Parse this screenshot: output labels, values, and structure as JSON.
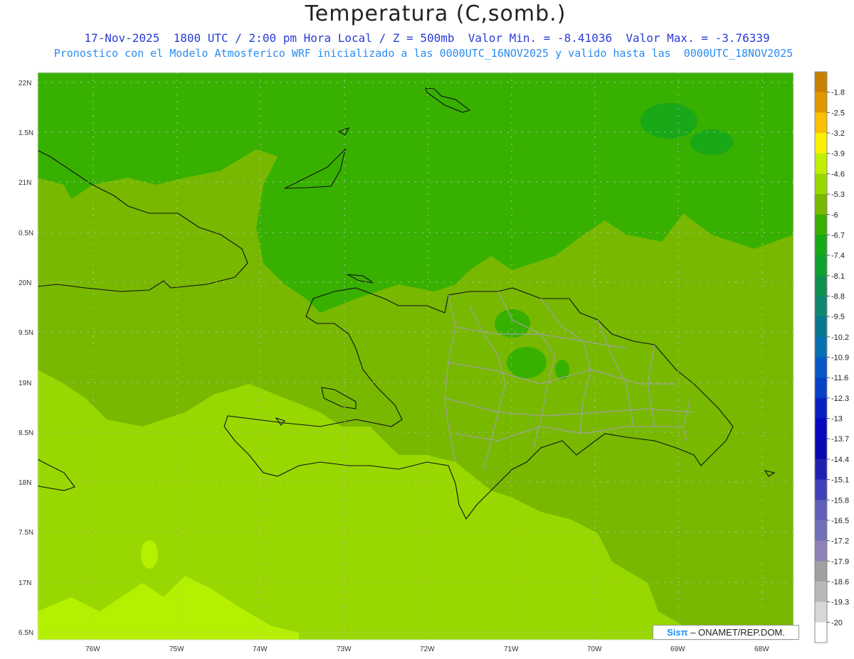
{
  "header": {
    "title": "Temperatura (C,somb.)",
    "line1": "17-Nov-2025  1800 UTC / 2:00 pm Hora Local / Z = 500mb  Valor Min. = -8.41036  Valor Max. = -3.76339",
    "line2": "Pronostico con el Modelo Atmosferico WRF inicializado a las 0000UTC_16NOV2025 y valido hasta las  0000UTC_18NOV2025"
  },
  "axes": {
    "lat_labels": [
      "22N",
      "1.5N",
      "21N",
      "0.5N",
      "20N",
      "9.5N",
      "19N",
      "8.5N",
      "18N",
      "7.5N",
      "17N",
      "6.5N"
    ],
    "lon_labels": [
      "76W",
      "75W",
      "74W",
      "73W",
      "72W",
      "71W",
      "70W",
      "69W",
      "68W"
    ]
  },
  "colorbar": {
    "labels": [
      "-1.8",
      "-2.5",
      "-3.2",
      "-3.9",
      "-4.6",
      "-5.3",
      "-6",
      "-6.7",
      "-7.4",
      "-8.1",
      "-8.8",
      "-9.5",
      "-10.2",
      "-10.9",
      "-11.6",
      "-12.3",
      "-13",
      "-13.7",
      "-14.4",
      "-15.1",
      "-15.8",
      "-16.5",
      "-17.2",
      "-17.9",
      "-18.6",
      "-19.3",
      "-20"
    ],
    "colors": [
      "#c88000",
      "#e09800",
      "#f8c000",
      "#f8f000",
      "#c0f000",
      "#98d800",
      "#78b800",
      "#38b000",
      "#18a818",
      "#10a030",
      "#109050",
      "#108870",
      "#087890",
      "#0870b0",
      "#0858c8",
      "#0840c8",
      "#0820c0",
      "#0808c0",
      "#0808b0",
      "#2020b0",
      "#4040b8",
      "#6060b8",
      "#7070b8",
      "#9080b8",
      "#a0a0a0",
      "#b8b8b8",
      "#d8d8d8",
      "#ffffff"
    ]
  },
  "field_colors": {
    "light": "#98d800",
    "lightest": "#b4f000",
    "mid": "#78b800",
    "dark": "#38b000",
    "darker": "#18a818"
  },
  "credit": {
    "logo": "Sisπ",
    "text": "– ONAMET/REP.DOM."
  }
}
